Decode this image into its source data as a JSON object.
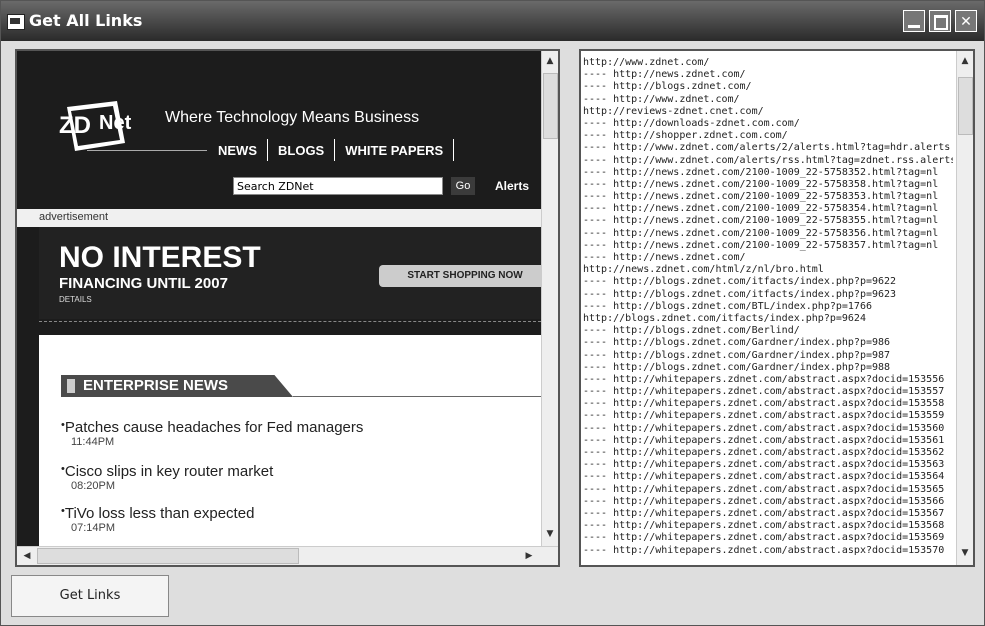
{
  "window": {
    "title": "Get All Links"
  },
  "browser": {
    "tagline": "Where Technology Means Business",
    "nav": [
      "NEWS",
      "BLOGS",
      "WHITE PAPERS"
    ],
    "search": {
      "value": "Search ZDNet",
      "go_label": "Go",
      "alerts_label": "Alerts"
    },
    "advertisement_label": "advertisement",
    "banner": {
      "title": "NO INTEREST",
      "subtitle": "FINANCING UNTIL 2007",
      "details": "DETAILS",
      "button": "START SHOPPING NOW"
    },
    "section_title": "ENTERPRISE NEWS",
    "news": [
      {
        "title": "Patches cause headaches for Fed managers",
        "time": "11:44PM"
      },
      {
        "title": "Cisco slips in key router market",
        "time": "08:20PM"
      },
      {
        "title": "TiVo loss less than expected",
        "time": "07:14PM"
      }
    ]
  },
  "links": [
    "http://www.zdnet.com/",
    "---- http://news.zdnet.com/",
    "---- http://blogs.zdnet.com/",
    "---- http://www.zdnet.com/",
    "http://reviews-zdnet.cnet.com/",
    "---- http://downloads-zdnet.com.com/",
    "---- http://shopper.zdnet.com.com/",
    "---- http://www.zdnet.com/alerts/2/alerts.html?tag=hdr.alerts",
    "---- http://www.zdnet.com/alerts/rss.html?tag=zdnet.rss.alerts",
    "---- http://news.zdnet.com/2100-1009_22-5758352.html?tag=nl",
    "---- http://news.zdnet.com/2100-1009_22-5758358.html?tag=nl",
    "---- http://news.zdnet.com/2100-1009_22-5758353.html?tag=nl",
    "---- http://news.zdnet.com/2100-1009_22-5758354.html?tag=nl",
    "---- http://news.zdnet.com/2100-1009_22-5758355.html?tag=nl",
    "---- http://news.zdnet.com/2100-1009_22-5758356.html?tag=nl",
    "---- http://news.zdnet.com/2100-1009_22-5758357.html?tag=nl",
    "---- http://news.zdnet.com/",
    "http://news.zdnet.com/html/z/nl/bro.html",
    "---- http://blogs.zdnet.com/itfacts/index.php?p=9622",
    "---- http://blogs.zdnet.com/itfacts/index.php?p=9623",
    "---- http://blogs.zdnet.com/BTL/index.php?p=1766",
    "http://blogs.zdnet.com/itfacts/index.php?p=9624",
    "---- http://blogs.zdnet.com/Berlind/",
    "---- http://blogs.zdnet.com/Gardner/index.php?p=986",
    "---- http://blogs.zdnet.com/Gardner/index.php?p=987",
    "---- http://blogs.zdnet.com/Gardner/index.php?p=988",
    "---- http://whitepapers.zdnet.com/abstract.aspx?docid=153556",
    "---- http://whitepapers.zdnet.com/abstract.aspx?docid=153557",
    "---- http://whitepapers.zdnet.com/abstract.aspx?docid=153558",
    "---- http://whitepapers.zdnet.com/abstract.aspx?docid=153559",
    "---- http://whitepapers.zdnet.com/abstract.aspx?docid=153560",
    "---- http://whitepapers.zdnet.com/abstract.aspx?docid=153561",
    "---- http://whitepapers.zdnet.com/abstract.aspx?docid=153562",
    "---- http://whitepapers.zdnet.com/abstract.aspx?docid=153563",
    "---- http://whitepapers.zdnet.com/abstract.aspx?docid=153564",
    "---- http://whitepapers.zdnet.com/abstract.aspx?docid=153565",
    "---- http://whitepapers.zdnet.com/abstract.aspx?docid=153566",
    "---- http://whitepapers.zdnet.com/abstract.aspx?docid=153567",
    "---- http://whitepapers.zdnet.com/abstract.aspx?docid=153568",
    "---- http://whitepapers.zdnet.com/abstract.aspx?docid=153569",
    "---- http://whitepapers.zdnet.com/abstract.aspx?docid=153570"
  ],
  "bottom_button": {
    "label": "Get Links"
  }
}
